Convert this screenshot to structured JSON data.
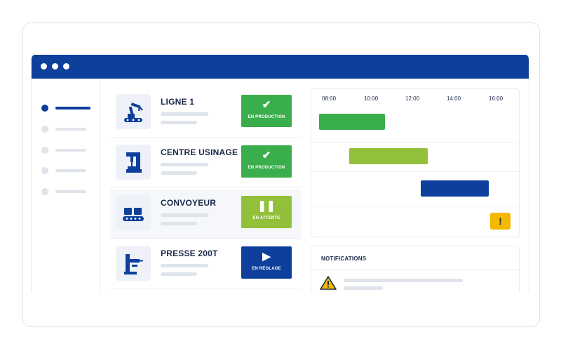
{
  "colors": {
    "brand_blue": "#0e3f9c",
    "production_green": "#3aae4c",
    "waiting_lime": "#93c03b",
    "warning_yellow": "#f5b800"
  },
  "sidebar": {
    "items": [
      {
        "state": "active"
      },
      {
        "state": "inactive"
      },
      {
        "state": "inactive"
      },
      {
        "state": "inactive"
      },
      {
        "state": "inactive"
      }
    ]
  },
  "machines": [
    {
      "name": "LIGNE 1",
      "icon": "robot-arm-icon",
      "status_label": "EN PRODUCTION",
      "status_icon": "check-icon",
      "status_color": "#3aae4c"
    },
    {
      "name": "CENTRE USINAGE",
      "icon": "cnc-machine-icon",
      "status_label": "EN PRODUCTION",
      "status_icon": "check-icon",
      "status_color": "#3aae4c"
    },
    {
      "name": "CONVOYEUR",
      "icon": "conveyor-icon",
      "status_label": "EN ATTENTE",
      "status_icon": "pause-icon",
      "status_color": "#93c03b"
    },
    {
      "name": "PRESSE 200T",
      "icon": "press-icon",
      "status_label": "EN RÉGLAGE",
      "status_icon": "play-icon",
      "status_color": "#0e3f9c"
    }
  ],
  "timeline": {
    "hours": [
      "08:00",
      "10:00",
      "12:00",
      "14:00",
      "16:00"
    ],
    "warning_icon": "exclamation-icon",
    "warning_text": "!"
  },
  "notifications": {
    "title": "NOTIFICATIONS",
    "items": [
      {
        "icon": "warning-triangle-icon"
      }
    ]
  }
}
